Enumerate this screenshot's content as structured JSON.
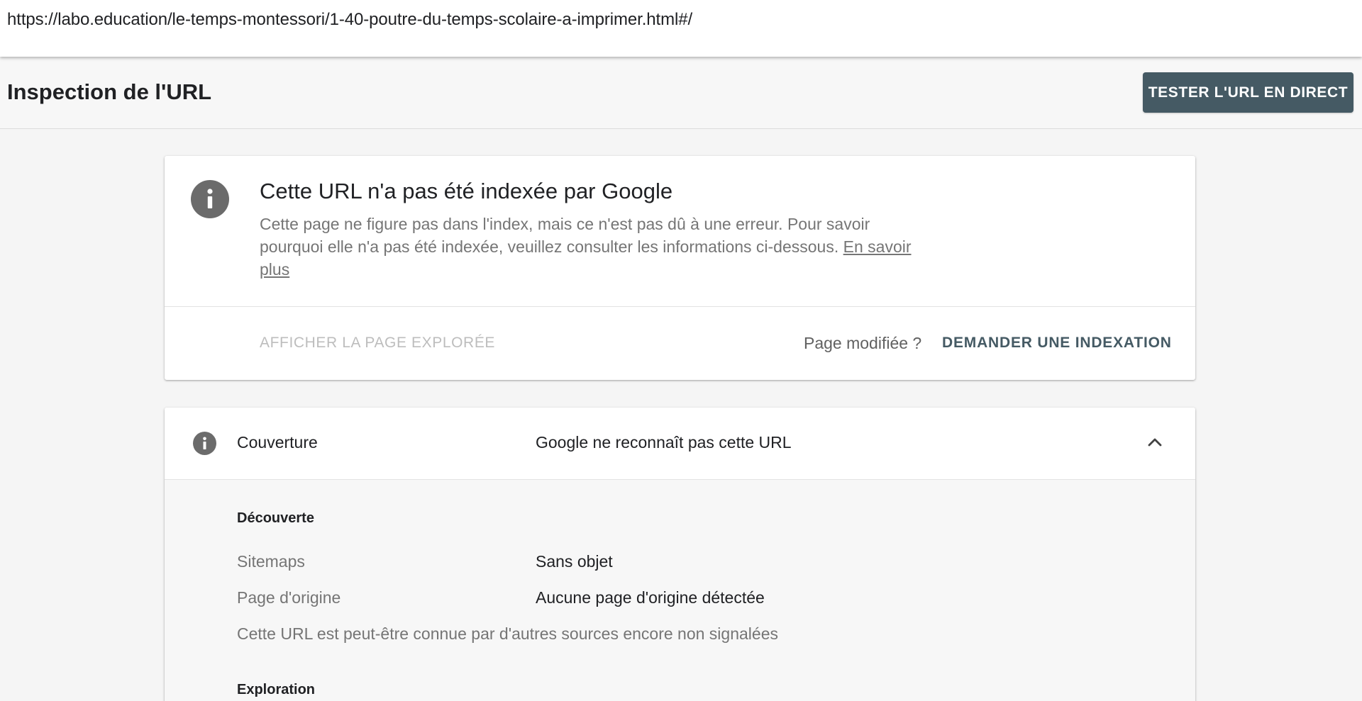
{
  "url_bar": {
    "url": "https://labo.education/le-temps-montessori/1-40-poutre-du-temps-scolaire-a-imprimer.html#/"
  },
  "header": {
    "title": "Inspection de l'URL",
    "live_test_label": "TESTER L'URL EN DIRECT"
  },
  "status_card": {
    "icon": "info-icon",
    "title": "Cette URL n'a pas été indexée par Google",
    "description": "Cette page ne figure pas dans l'index, mais ce n'est pas dû à une erreur. Pour savoir pourquoi elle n'a pas été indexée, veuillez consulter les informations ci-dessous.",
    "learn_more": "En savoir plus",
    "view_crawled_label": "AFFICHER LA PAGE EXPLORÉE",
    "page_modified_label": "Page modifiée ?",
    "request_indexing_label": "DEMANDER UNE INDEXATION"
  },
  "coverage": {
    "icon": "info-icon",
    "label": "Couverture",
    "value": "Google ne reconnaît pas cette URL",
    "expanded": true,
    "discovery": {
      "heading": "Découverte",
      "sitemaps_label": "Sitemaps",
      "sitemaps_value": "Sans objet",
      "referring_page_label": "Page d'origine",
      "referring_page_value": "Aucune page d'origine détectée",
      "note": "Cette URL est peut-être connue par d'autres sources encore non signalées"
    },
    "crawl": {
      "heading": "Exploration"
    }
  },
  "colors": {
    "accent": "#455a64",
    "icon_gray": "#6b6b6b",
    "muted_text": "#757575",
    "disabled_text": "#bdbdbd"
  }
}
